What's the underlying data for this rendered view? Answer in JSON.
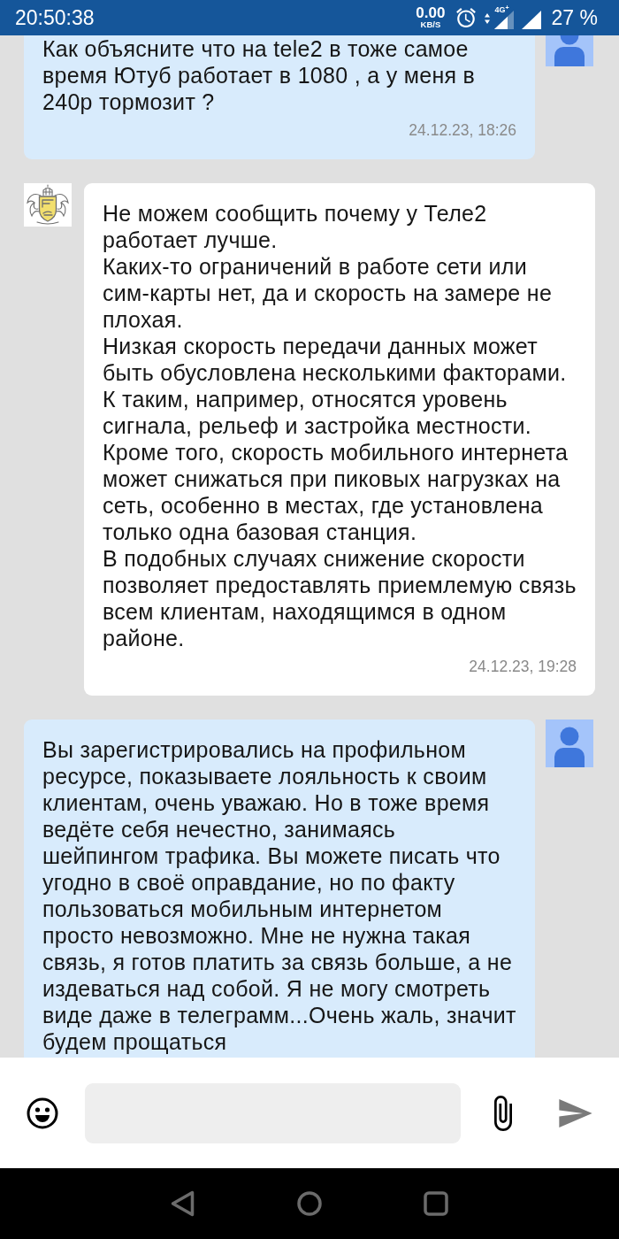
{
  "status_bar": {
    "time": "20:50:38",
    "net_speed": "0.00",
    "net_speed_unit": "KB/S",
    "network_type": "4G$^{+}$",
    "battery": "27 %"
  },
  "messages": [
    {
      "kind": "outgoing",
      "text": "Как объясните что на tele2 в тоже самое время Ютуб работает в 1080 , а у меня в 240p тормозит ?",
      "time": "24.12.23, 18:26"
    },
    {
      "kind": "incoming",
      "text": "Не можем сообщить почему у Теле2 работает лучше.\nКаких-то ограничений в работе сети или сим-карты нет, да и скорость на замере не плохая.\nНизкая скорость передачи данных может быть обусловлена несколькими факторами.\nК таким, например, относятся уровень сигнала, рельеф и застройка местности.\nКроме того, скорость мобильного интернета может снижаться при пиковых нагрузках на сеть, особенно в местах, где установлена только одна базовая станция.\nВ подобных случаях снижение скорости позволяет предоставлять приемлемую связь всем клиентам, находящимся в одном районе.",
      "time": "24.12.23, 19:28"
    },
    {
      "kind": "outgoing",
      "text": "Вы зарегистрировались на профильном ресурсе, показываете лояльность к своим клиентам, очень уважаю. Но в тоже время ведёте себя нечестно, занимаясь шейпингом трафика. Вы можете писать что угодно в своё оправдание, но по факту пользоваться мобильным интернетом просто невозможно. Мне не нужна такая связь, я готов платить за связь больше, а не издеваться над собой. Я не могу смотреть виде даже в телеграмм...Очень жаль, значит будем прощаться"
    }
  ]
}
